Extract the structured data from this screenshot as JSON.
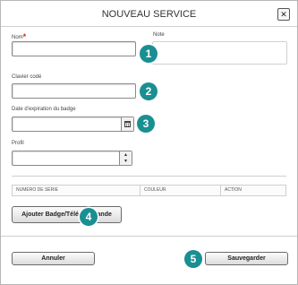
{
  "dialog": {
    "title": "NOUVEAU SERVICE",
    "close_icon": "close-icon"
  },
  "form": {
    "nom": {
      "label": "Nom",
      "required_mark": "*",
      "value": ""
    },
    "note": {
      "label": "Note",
      "value": ""
    },
    "clavier_code": {
      "label": "Clavier codé",
      "value": ""
    },
    "date_expiration": {
      "label": "Date d'expiration du badge",
      "value": "",
      "icon": "calendar-icon"
    },
    "profil": {
      "label": "Profil",
      "value": "",
      "icon": "spinner-arrows-icon"
    }
  },
  "badge_table": {
    "columns": [
      "NUMÉRO DE SÉRIE",
      "COULEUR",
      "ACTION"
    ],
    "rows": []
  },
  "buttons": {
    "add_badge": "Ajouter Badge/Télécommande",
    "cancel": "Annuler",
    "save": "Sauvegarder"
  },
  "callouts": [
    "1",
    "2",
    "3",
    "4",
    "5"
  ],
  "colors": {
    "callout": "#1a8f92",
    "required": "#d22222"
  }
}
